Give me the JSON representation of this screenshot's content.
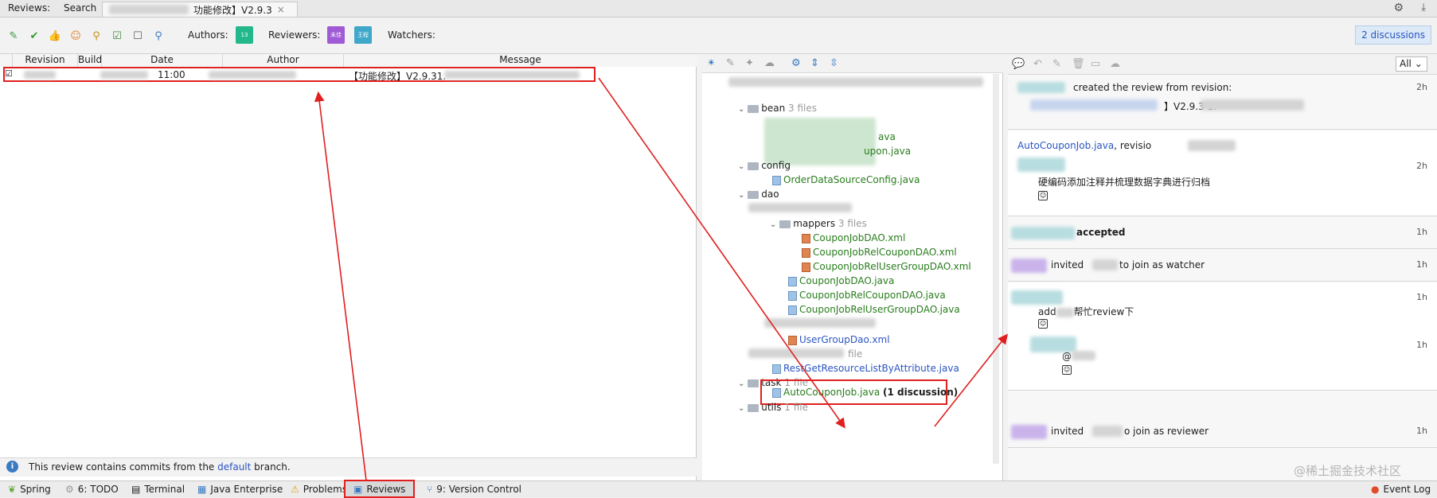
{
  "tabbar": {
    "reviews_label": "Reviews:",
    "search_label": "Search",
    "tab_title": "功能修改】V2.9.3",
    "close_glyph": "×"
  },
  "toolbar": {
    "authors_label": "Authors:",
    "reviewers_label": "Reviewers:",
    "watchers_label": "Watchers:",
    "discussions_button": "2 discussions",
    "author_avatar_text": "13",
    "reviewer_avatar1_text": "未佳",
    "reviewer_avatar2_text": "王程"
  },
  "table": {
    "columns": [
      "Revision",
      "Build",
      "Date",
      "Author",
      "Message"
    ],
    "row": {
      "date": "11:00",
      "message": "【功能修改】V2.9.31."
    }
  },
  "infobar": {
    "text_before": "This review contains commits from the ",
    "link": "default",
    "text_after": " branch."
  },
  "tree": {
    "bean": "bean",
    "bean_count": "3 files",
    "bean_file1": "ava",
    "bean_file2": "upon.java",
    "config": "config",
    "config_file": "OrderDataSourceConfig.java",
    "dao": "dao",
    "mappers": "mappers",
    "mappers_count": "3 files",
    "xml1": "CouponJobDAO.xml",
    "xml2": "CouponJobRelCouponDAO.xml",
    "xml3": "CouponJobRelUserGroupDAO.xml",
    "java1": "CouponJobDAO.java",
    "java2": "CouponJobRelCouponDAO.java",
    "java3": "CouponJobRelUserGroupDAO.java",
    "usergroup": "UserGroupDao.xml",
    "onefile": "file",
    "rest": "RestGetResourceListByAttribute.java",
    "task": "task",
    "task_count": "1 file",
    "autocoupon": "AutoCouponJob.java",
    "discussion_count": "(1 discussion)",
    "utils": "utils",
    "utils_count": "1 file"
  },
  "right": {
    "filter": "All",
    "card1_title": "created the review from revision:",
    "card1_sub": "】V2.9.3 1.",
    "card2_link": "AutoCouponJob.java",
    "card2_suffix": ", revisio",
    "card2_comment": "硬编码添加注释并梳理数据字典进行归档",
    "card3_text": "accepted",
    "card4_text": "invited",
    "card4_suffix": "to join as watcher",
    "card5_text": "add",
    "card5_suffix": "帮忙review下",
    "card5_reply": "@",
    "card6_text": "invited",
    "card6_suffix": "o join as reviewer",
    "times": [
      "2h",
      "2h",
      "1h",
      "1h",
      "1h",
      "1h",
      "1h"
    ]
  },
  "statusbar": {
    "spring": "Spring",
    "todo": "6: TODO",
    "terminal": "Terminal",
    "java_ee": "Java Enterprise",
    "problems": "Problems",
    "reviews": "Reviews",
    "vcs": "9: Version Control",
    "event_log": "Event Log",
    "watermark": "@稀土掘金技术社区"
  },
  "colors": {
    "accent_red": "#e01f1f",
    "link_blue": "#2a55c2",
    "added_green": "#287c1c"
  }
}
